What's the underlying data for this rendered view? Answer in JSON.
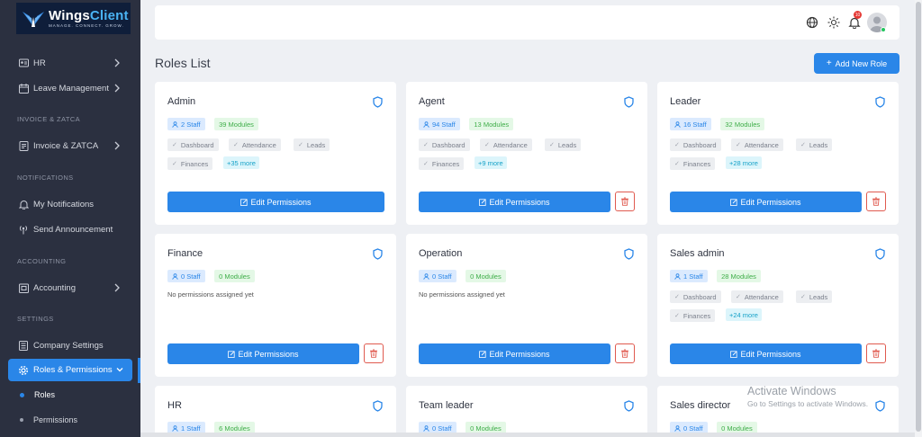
{
  "brand": {
    "name_part1": "Wings",
    "name_part2": "Client",
    "tagline": "MANAGE. CONNECT. GROW."
  },
  "sidebar": {
    "items": [
      {
        "label": "HR"
      },
      {
        "label": "Leave Management"
      },
      {
        "label": "Invoice & ZATCA"
      },
      {
        "label": "My Notifications"
      },
      {
        "label": "Send Announcement"
      },
      {
        "label": "Accounting"
      },
      {
        "label": "Company Settings"
      },
      {
        "label": "Roles & Permissions"
      }
    ],
    "sections": [
      "INVOICE & ZATCA",
      "NOTIFICATIONS",
      "ACCOUNTING",
      "SETTINGS"
    ],
    "subitems": [
      {
        "label": "Roles"
      },
      {
        "label": "Permissions"
      }
    ]
  },
  "topbar": {
    "notification_count": "10"
  },
  "page": {
    "title": "Roles List",
    "add_button": "Add New Role"
  },
  "roles": [
    {
      "name": "Admin",
      "staff": "2 Staff",
      "modules": "39 Modules",
      "perms": [
        "Dashboard",
        "Attendance",
        "Leads",
        "Finances"
      ],
      "more": "+35 more",
      "edit": "Edit Permissions"
    },
    {
      "name": "Agent",
      "staff": "94 Staff",
      "modules": "13 Modules",
      "perms": [
        "Dashboard",
        "Attendance",
        "Leads",
        "Finances"
      ],
      "more": "+9 more",
      "edit": "Edit Permissions"
    },
    {
      "name": "Leader",
      "staff": "16 Staff",
      "modules": "32 Modules",
      "perms": [
        "Dashboard",
        "Attendance",
        "Leads",
        "Finances"
      ],
      "more": "+28 more",
      "edit": "Edit Permissions"
    },
    {
      "name": "Finance",
      "staff": "0 Staff",
      "modules": "0 Modules",
      "empty": "No permissions assigned yet",
      "edit": "Edit Permissions"
    },
    {
      "name": "Operation",
      "staff": "0 Staff",
      "modules": "0 Modules",
      "empty": "No permissions assigned yet",
      "edit": "Edit Permissions"
    },
    {
      "name": "Sales admin",
      "staff": "1 Staff",
      "modules": "28 Modules",
      "perms": [
        "Dashboard",
        "Attendance",
        "Leads",
        "Finances"
      ],
      "more": "+24 more",
      "edit": "Edit Permissions"
    },
    {
      "name": "HR",
      "staff": "1 Staff",
      "modules": "6 Modules"
    },
    {
      "name": "Team leader",
      "staff": "0 Staff",
      "modules": "0 Modules"
    },
    {
      "name": "Sales director",
      "staff": "0 Staff",
      "modules": "0 Modules"
    }
  ],
  "watermark": {
    "title": "Activate Windows",
    "subtitle": "Go to Settings to activate Windows."
  },
  "colors": {
    "sidebar_bg": "#2b3040",
    "accent": "#2a86e8",
    "danger": "#e05a4f",
    "success_text": "#3fae49"
  }
}
